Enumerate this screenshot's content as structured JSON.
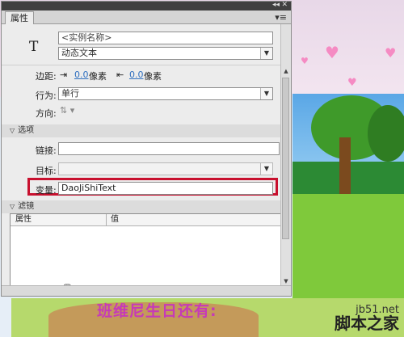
{
  "panel": {
    "tab_label": "属性",
    "instance_name_placeholder": "<实例名称>",
    "text_type": "动态文本",
    "margin_label": "边距:",
    "margin_left_value": "0.0",
    "margin_left_unit": "像素",
    "margin_right_value": "0.0",
    "margin_right_unit": "像素",
    "behavior_label": "行为:",
    "behavior_value": "单行",
    "direction_label": "方向:",
    "options_section": "选项",
    "link_label": "链接:",
    "link_value": "",
    "target_label": "目标:",
    "target_value": "",
    "variable_label": "变量:",
    "variable_value": "DaoJiShiText",
    "filters_section": "滤镜",
    "filters_col_property": "属性",
    "filters_col_value": "值"
  },
  "stage": {
    "birthday_text": "班维尼生日还有:"
  },
  "watermark": {
    "site": "jb51.net",
    "name": "脚本之家"
  },
  "colors": {
    "highlight": "#c8102e",
    "link_blue": "#2f6fbf"
  },
  "icons": [
    "type-tool-icon",
    "collapse-icon",
    "close-icon",
    "panel-menu-icon",
    "margin-left-icon",
    "margin-right-icon",
    "direction-icon",
    "dropdown-arrow-icon",
    "section-collapse-icon",
    "filter-toolbar-icons",
    "heart-icon"
  ]
}
